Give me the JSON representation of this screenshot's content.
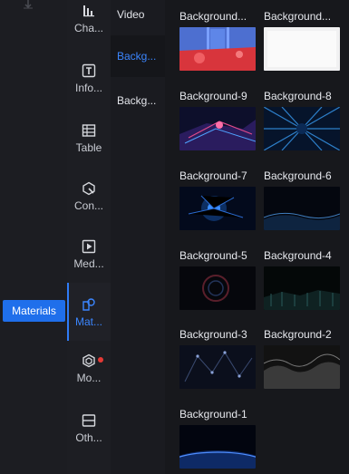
{
  "app": {
    "materials_badge": "Materials"
  },
  "categories": [
    {
      "label": "Cha...",
      "icon": "chart-icon"
    },
    {
      "label": "Info...",
      "icon": "text-icon"
    },
    {
      "label": "Table",
      "icon": "table-icon"
    },
    {
      "label": "Con...",
      "icon": "control-icon"
    },
    {
      "label": "Med...",
      "icon": "media-icon"
    },
    {
      "label": "Mat...",
      "icon": "materials-icon",
      "active": true
    },
    {
      "label": "Mo...",
      "icon": "model-icon",
      "badge": true
    },
    {
      "label": "Oth...",
      "icon": "other-icon"
    }
  ],
  "subcategories": [
    {
      "label": "Video"
    },
    {
      "label": "Backg...",
      "active": true
    },
    {
      "label": "Backg..."
    }
  ],
  "backgrounds": [
    {
      "title": "Background..."
    },
    {
      "title": "Background..."
    },
    {
      "title": "Background-9"
    },
    {
      "title": "Background-8"
    },
    {
      "title": "Background-7"
    },
    {
      "title": "Background-6"
    },
    {
      "title": "Background-5"
    },
    {
      "title": "Background-4"
    },
    {
      "title": "Background-3"
    },
    {
      "title": "Background-2"
    },
    {
      "title": "Background-1"
    }
  ],
  "colors": {
    "accent": "#1f6feb",
    "active_text": "#3b86ff",
    "badge": "#e53935"
  }
}
